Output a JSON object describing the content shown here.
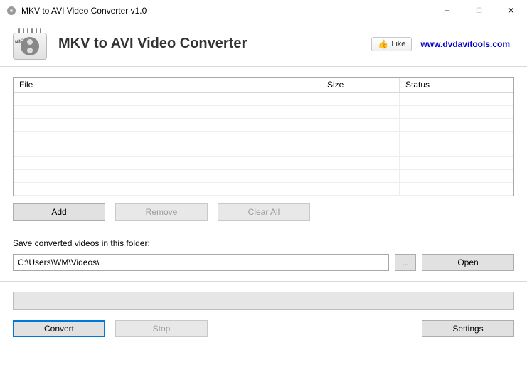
{
  "window": {
    "title": "MKV to AVI Video Converter v1.0"
  },
  "header": {
    "app_title": "MKV to AVI Video Converter",
    "like_label": "Like",
    "website": "www.dvdavitools.com",
    "logo_tag": "MKV"
  },
  "table": {
    "columns": {
      "file": "File",
      "size": "Size",
      "status": "Status"
    }
  },
  "buttons": {
    "add": "Add",
    "remove": "Remove",
    "clear_all": "Clear All",
    "browse": "...",
    "open": "Open",
    "convert": "Convert",
    "stop": "Stop",
    "settings": "Settings"
  },
  "output": {
    "label": "Save converted videos in this folder:",
    "path": "C:\\Users\\WM\\Videos\\"
  }
}
